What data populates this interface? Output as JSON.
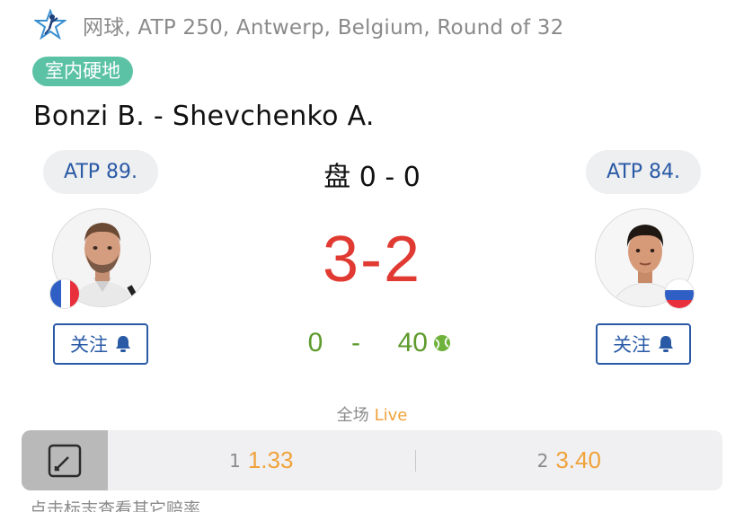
{
  "header": {
    "logo_icon": "tennis-star-logo-icon",
    "tournament": "网球, ATP 250, Antwerp, Belgium, Round of 32"
  },
  "surface": "室内硬地",
  "match": {
    "title": "Bonzi B. - Shevchenko A."
  },
  "players": {
    "left": {
      "rank": "ATP 89.",
      "flag_icon": "france-flag-icon",
      "follow_label": "关注"
    },
    "right": {
      "rank": "ATP 84.",
      "flag_icon": "russia-flag-icon",
      "follow_label": "关注"
    }
  },
  "score": {
    "sets_text": "盘 0 - 0",
    "games_text": "3-2",
    "points_left": "0",
    "points_sep": "-",
    "points_right": "40",
    "serve_icon": "tennis-ball-icon"
  },
  "market": {
    "label": "全场",
    "live": "Live",
    "odds": [
      {
        "key": "1",
        "value": "1.33"
      },
      {
        "key": "2",
        "value": "3.40"
      }
    ]
  },
  "hint": "点击标志查看其它赔率",
  "colors": {
    "accent_blue": "#2a5aa6",
    "games_red": "#e03a33",
    "points_green": "#5e9a2c",
    "odds_orange": "#f0a23a",
    "surface_teal": "#5cc2a6"
  }
}
